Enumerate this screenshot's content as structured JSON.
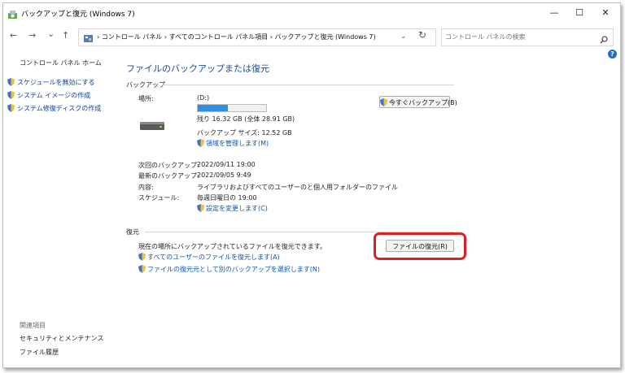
{
  "window": {
    "title": "バックアップと復元 (Windows 7)",
    "minimize": "—",
    "maximize": "☐",
    "close": "✕"
  },
  "nav": {
    "back": "←",
    "forward": "→",
    "recent": "⌄",
    "up": "↑",
    "breadcrumb": "›  コントロール パネル  ›  すべてのコントロール パネル項目  ›  バックアップと復元 (Windows 7)",
    "dropdown": "⌄",
    "refresh": "↻"
  },
  "search": {
    "placeholder": "コントロール パネルの検索"
  },
  "help": "?",
  "sidebar": {
    "home": "コントロール パネル ホーム",
    "items": [
      {
        "label": "スケジュールを無効にする"
      },
      {
        "label": "システム イメージの作成"
      },
      {
        "label": "システム修復ディスクの作成"
      }
    ],
    "related_heading": "関連項目",
    "related": [
      {
        "label": "セキュリティとメンテナンス"
      },
      {
        "label": "ファイル履歴"
      }
    ]
  },
  "main": {
    "heading": "ファイルのバックアップまたは復元",
    "backup": {
      "group_label": "バックアップ",
      "location_label": "場所:",
      "location_value": "(D:)",
      "usage_fraction": 0.44,
      "free_text": "残り 16.32 GB (全体 28.91 GB)",
      "size_text": "バックアップ サイズ: 12.52 GB",
      "manage_link": "領域を管理します(M)",
      "backup_now_button": "今すぐバックアップ(B)",
      "next_label": "次回のバックアップ:",
      "next_value": "2022/09/11 19:00",
      "last_label": "最新のバックアップ:",
      "last_value": "2022/09/05 9:49",
      "contents_label": "内容:",
      "contents_value": "ライブラリおよびすべてのユーザーのと個人用フォルダーのファイル",
      "schedule_label": "スケジュール:",
      "schedule_value": "毎週日曜日の 19:00",
      "change_settings_link": "設定を変更します(C)"
    },
    "restore": {
      "group_label": "復元",
      "description": "現在の場所にバックアップされているファイルを復元できます。",
      "restore_button": "ファイルの復元(R)",
      "restore_all_link": "すべてのユーザーのファイルを復元します(A)",
      "select_other_link": "ファイルの復元元として別のバックアップを選択します(N)"
    }
  },
  "colors": {
    "link": "#0b57b0",
    "heading": "#1b4a9c",
    "highlight": "#e02020",
    "progress": "#2f8ee0"
  }
}
